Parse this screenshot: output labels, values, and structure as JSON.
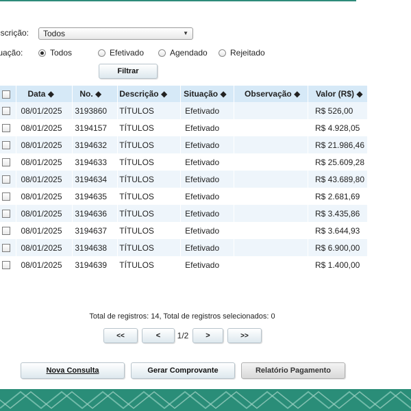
{
  "filters": {
    "descricao_label": "escrição:",
    "descricao_value": "Todos",
    "situacao_label": "tuação:",
    "situacao_options": [
      "Todos",
      "Efetivado",
      "Agendado",
      "Rejeitado"
    ],
    "situacao_selected": "Todos",
    "filtrar_label": "Filtrar"
  },
  "table": {
    "headers": [
      "Data ◆",
      "No. ◆",
      "Descrição ◆",
      "Situação ◆",
      "Observação ◆",
      "Valor (R$) ◆"
    ],
    "rows": [
      {
        "data": "08/01/2025",
        "no": "3193860",
        "descricao": "TÍTULOS",
        "situacao": "Efetivado",
        "observacao": "",
        "valor": "R$ 526,00"
      },
      {
        "data": "08/01/2025",
        "no": "3194157",
        "descricao": "TÍTULOS",
        "situacao": "Efetivado",
        "observacao": "",
        "valor": "R$ 4.928,05"
      },
      {
        "data": "08/01/2025",
        "no": "3194632",
        "descricao": "TÍTULOS",
        "situacao": "Efetivado",
        "observacao": "",
        "valor": "R$ 21.986,46"
      },
      {
        "data": "08/01/2025",
        "no": "3194633",
        "descricao": "TÍTULOS",
        "situacao": "Efetivado",
        "observacao": "",
        "valor": "R$ 25.609,28"
      },
      {
        "data": "08/01/2025",
        "no": "3194634",
        "descricao": "TÍTULOS",
        "situacao": "Efetivado",
        "observacao": "",
        "valor": "R$ 43.689,80"
      },
      {
        "data": "08/01/2025",
        "no": "3194635",
        "descricao": "TÍTULOS",
        "situacao": "Efetivado",
        "observacao": "",
        "valor": "R$ 2.681,69"
      },
      {
        "data": "08/01/2025",
        "no": "3194636",
        "descricao": "TÍTULOS",
        "situacao": "Efetivado",
        "observacao": "",
        "valor": "R$ 3.435,86"
      },
      {
        "data": "08/01/2025",
        "no": "3194637",
        "descricao": "TÍTULOS",
        "situacao": "Efetivado",
        "observacao": "",
        "valor": "R$ 3.644,93"
      },
      {
        "data": "08/01/2025",
        "no": "3194638",
        "descricao": "TÍTULOS",
        "situacao": "Efetivado",
        "observacao": "",
        "valor": "R$ 6.900,00"
      },
      {
        "data": "08/01/2025",
        "no": "3194639",
        "descricao": "TÍTULOS",
        "situacao": "Efetivado",
        "observacao": "",
        "valor": "R$ 1.400,00"
      }
    ]
  },
  "summary": "Total de registros: 14, Total de registros selecionados: 0",
  "pager": {
    "first": "<<",
    "prev": "<",
    "current": "1/2",
    "next": ">",
    "last": ">>"
  },
  "actions": {
    "nova_consulta": "Nova Consulta",
    "gerar_comprovante": "Gerar Comprovante",
    "relatorio_pagamento": "Relatório Pagamento"
  },
  "colors": {
    "accent": "#2a8d78",
    "header_bg": "#d6e9f7",
    "row_alt": "#eef5fb"
  }
}
